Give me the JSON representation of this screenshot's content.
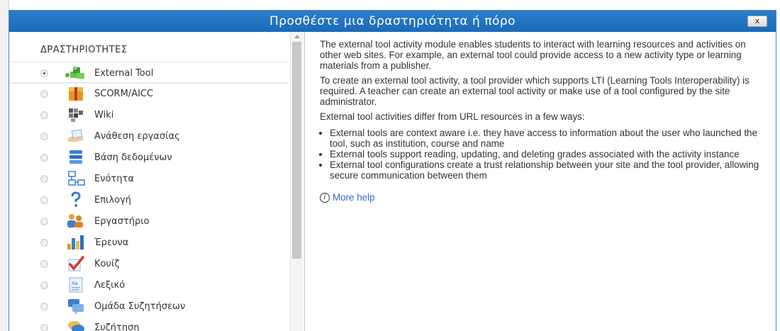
{
  "dialog": {
    "title": "Προσθέστε μια δραστηριότητα ή πόρο",
    "close_label": "x"
  },
  "sidebar": {
    "heading": "ΔΡΑΣΤΗΡΙΟΤΗΤΕΣ",
    "items": [
      {
        "label": "External Tool",
        "icon": "external-tool-icon",
        "selected": true
      },
      {
        "label": "SCORM/AICC",
        "icon": "scorm-package-icon",
        "selected": false
      },
      {
        "label": "Wiki",
        "icon": "wiki-icon",
        "selected": false
      },
      {
        "label": "Ανάθεση εργασίας",
        "icon": "assignment-icon",
        "selected": false
      },
      {
        "label": "Βάση δεδομένων",
        "icon": "database-icon",
        "selected": false
      },
      {
        "label": "Ενότητα",
        "icon": "lesson-icon",
        "selected": false
      },
      {
        "label": "Επιλογή",
        "icon": "choice-icon",
        "selected": false
      },
      {
        "label": "Εργαστήριο",
        "icon": "workshop-icon",
        "selected": false
      },
      {
        "label": "Έρευνα",
        "icon": "survey-icon",
        "selected": false
      },
      {
        "label": "Κουίζ",
        "icon": "quiz-icon",
        "selected": false
      },
      {
        "label": "Λεξικό",
        "icon": "glossary-icon",
        "selected": false
      },
      {
        "label": "Ομάδα Συζητήσεων",
        "icon": "forum-icon",
        "selected": false
      },
      {
        "label": "Συζήτηση",
        "icon": "chat-icon",
        "selected": false
      }
    ]
  },
  "description": {
    "para1": "The external tool activity module enables students to interact with learning resources and activities on other web sites. For example, an external tool could provide access to a new activity type or learning materials from a publisher.",
    "para2": "To create an external tool activity, a tool provider which supports LTI (Learning Tools Interoperability) is required. A teacher can create an external tool activity or make use of a tool configured by the site administrator.",
    "para3": "External tool activities differ from URL resources in a few ways:",
    "bullets": [
      "External tools are context aware i.e. they have access to information about the user who launched the tool, such as institution, course and name",
      "External tools support reading, updating, and deleting grades associated with the activity instance",
      "External tool configurations create a trust relationship between your site and the tool provider, allowing secure communication between them"
    ],
    "more_help": "More help"
  },
  "colors": {
    "title_bar": "#1a6bb8",
    "link": "#2a6bc0"
  }
}
